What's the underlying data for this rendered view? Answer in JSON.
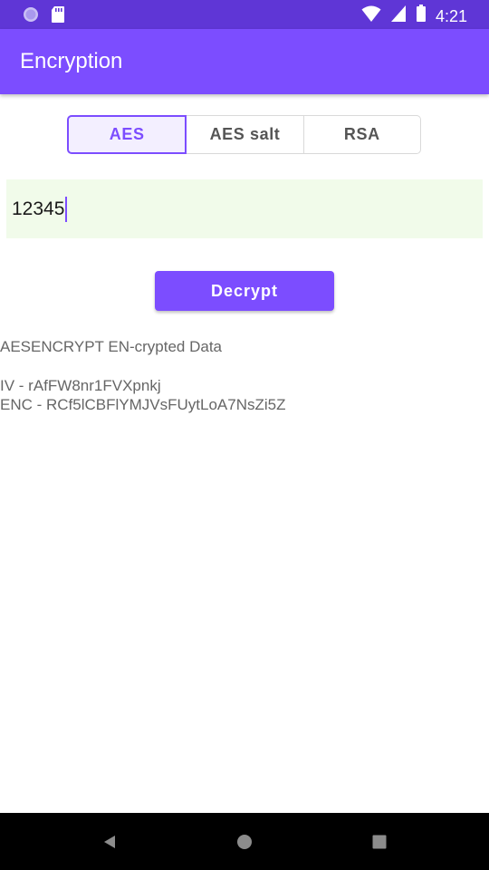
{
  "status_bar": {
    "time": "4:21",
    "icons": [
      "circle-notification-icon",
      "sd-card-icon",
      "wifi-icon",
      "cell-signal-icon",
      "battery-icon"
    ]
  },
  "app_bar": {
    "title": "Encryption"
  },
  "segmented": {
    "options": [
      "AES",
      "AES salt",
      "RSA"
    ],
    "selected": "AES"
  },
  "input": {
    "value": "12345"
  },
  "actions": {
    "decrypt_label": "Decrypt"
  },
  "output": {
    "heading": "AESENCRYPT EN-crypted Data",
    "iv_line": "IV - rAfFW8nr1FVXpnkj",
    "enc_line": "ENC - RCf5lCBFlYMJVsFUytLoA7NsZi5Z"
  },
  "nav_bar": {
    "icons": [
      "back-icon",
      "home-icon",
      "recents-icon"
    ]
  },
  "colors": {
    "status_bar": "#5f36d6",
    "primary": "#7c4dff",
    "input_background": "#f1fbea",
    "nav_bar": "#000000"
  }
}
